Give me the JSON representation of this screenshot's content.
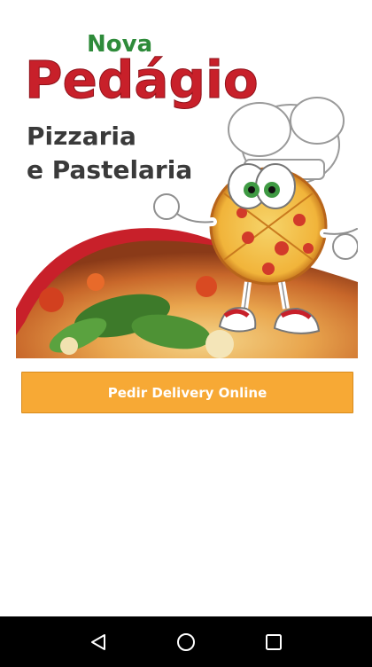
{
  "banner": {
    "brand_small": "Nova",
    "brand_main": "Pedágio",
    "tagline_line1": "Pizzaria",
    "tagline_line2": "e Pastelaria"
  },
  "cta": {
    "label": "Pedir Delivery Online"
  },
  "navbar": {
    "back_icon": "back-triangle",
    "home_icon": "home-circle",
    "recents_icon": "recents-square"
  },
  "colors": {
    "brand_red": "#c8202a",
    "brand_green": "#2e8b3a",
    "cta_orange": "#f7a935",
    "navbar_bg": "#000000"
  }
}
